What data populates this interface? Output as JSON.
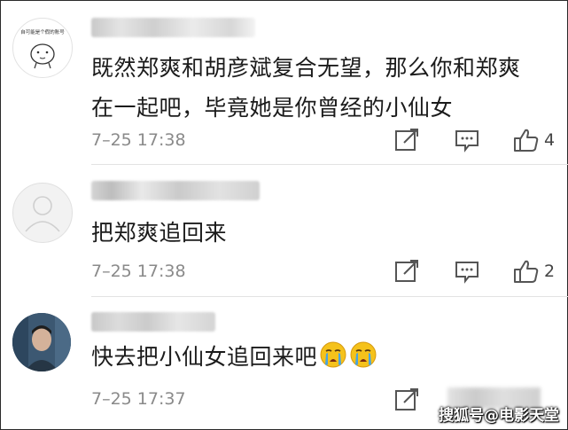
{
  "comments": [
    {
      "avatar_caption": "自可能是个假的账号",
      "text_line1": "既然郑爽和胡彦斌复合无望，那么你和郑爽",
      "text_line2": "在一起吧，毕竟她是你曾经的小仙女",
      "time": "7–25 17:38",
      "likes": "4"
    },
    {
      "text_line1": "把郑爽追回来",
      "time": "7–25 17:38",
      "likes": "2"
    },
    {
      "text_line1": "快去把小仙女追回来吧",
      "emoji": [
        "crying-face",
        "crying-face"
      ],
      "time": "7–25 17:37"
    }
  ],
  "icons": [
    "share-icon",
    "reply-icon",
    "like-icon"
  ],
  "watermark": "搜狐号@电影天堂",
  "colors": {
    "text": "#1b1b1b",
    "meta": "#8a8a8a",
    "icon": "#555555",
    "emoji": "#f5c21b"
  }
}
